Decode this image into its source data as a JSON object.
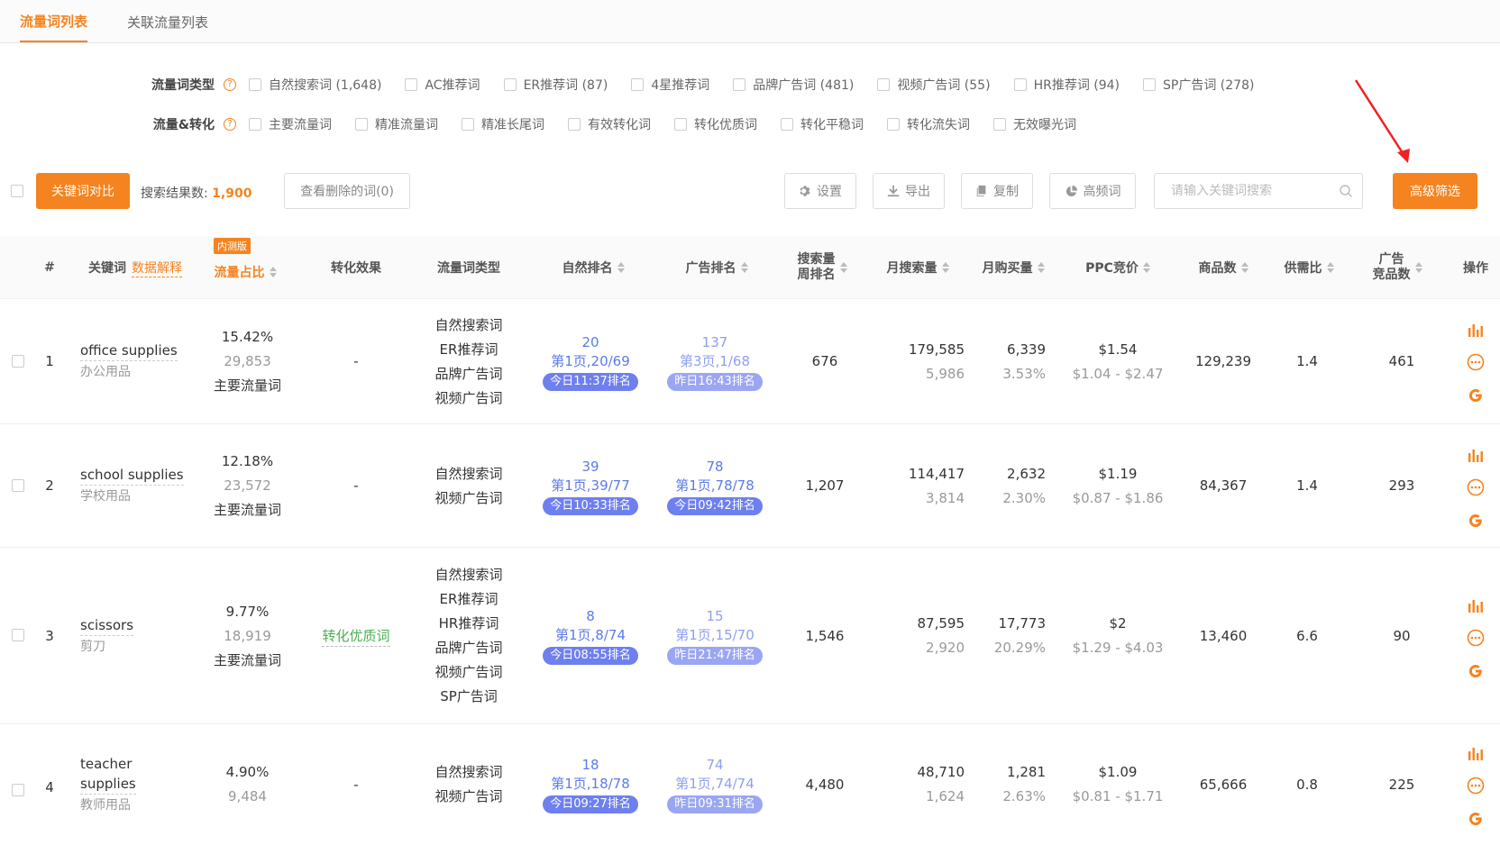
{
  "tabs": [
    {
      "label": "流量词列表"
    },
    {
      "label": "关联流量列表"
    }
  ],
  "filters": {
    "type_label": "流量词类型",
    "type_options": [
      "自然搜索词 (1,648)",
      "AC推荐词",
      "ER推荐词 (87)",
      "4星推荐词",
      "品牌广告词 (481)",
      "视频广告词 (55)",
      "HR推荐词 (94)",
      "SP广告词 (278)"
    ],
    "conv_label": "流量&转化",
    "conv_options": [
      "主要流量词",
      "精准流量词",
      "精准长尾词",
      "有效转化词",
      "转化优质词",
      "转化平稳词",
      "转化流失词",
      "无效曝光词"
    ]
  },
  "toolbar": {
    "compare_label": "关键词对比",
    "result_label": "搜索结果数:",
    "result_count": "1,900",
    "deleted_label": "查看删除的词(0)",
    "settings_label": "设置",
    "export_label": "导出",
    "copy_label": "复制",
    "highfreq_label": "高频词",
    "search_placeholder": "请输入关键词搜索",
    "advanced_label": "高级筛选"
  },
  "header": {
    "index": "#",
    "keyword": "关键词",
    "data_explain": "数据解释",
    "beta": "内测版",
    "share": "流量占比",
    "conversion": "转化效果",
    "type": "流量词类型",
    "natural_rank": "自然排名",
    "ad_rank": "广告排名",
    "weekly_rank_1": "搜索量",
    "weekly_rank_2": "周排名",
    "monthly_search": "月搜索量",
    "monthly_buy": "月购买量",
    "ppc": "PPC竞价",
    "products": "商品数",
    "supply": "供需比",
    "ad_comp_1": "广告",
    "ad_comp_2": "竞品数",
    "ops": "操作"
  },
  "rows": [
    {
      "index": "1",
      "kw_en": "office supplies",
      "kw_cn": "办公用品",
      "share": "15.42%",
      "share_count": "29,853",
      "share_type": "主要流量词",
      "conversion": "-",
      "types": [
        "自然搜索词",
        "ER推荐词",
        "品牌广告词",
        "视频广告词"
      ],
      "nat_rank": "20",
      "nat_page": "第1页,20/69",
      "nat_time": "今日11:37排名",
      "ad_rank": "137",
      "ad_page": "第3页,1/68",
      "ad_time": "昨日16:43排名",
      "weekly_rank": "676",
      "monthly_search": "179,585",
      "monthly_search_sub": "5,986",
      "monthly_buy": "6,339",
      "monthly_buy_rate": "3.53%",
      "ppc": "$1.54",
      "ppc_range": "$1.04 - $2.47",
      "products": "129,239",
      "supply": "1.4",
      "ad_comp": "461"
    },
    {
      "index": "2",
      "kw_en": "school supplies",
      "kw_cn": "学校用品",
      "share": "12.18%",
      "share_count": "23,572",
      "share_type": "主要流量词",
      "conversion": "-",
      "types": [
        "自然搜索词",
        "视频广告词"
      ],
      "nat_rank": "39",
      "nat_page": "第1页,39/77",
      "nat_time": "今日10:33排名",
      "ad_rank": "78",
      "ad_page": "第1页,78/78",
      "ad_time": "今日09:42排名",
      "weekly_rank": "1,207",
      "monthly_search": "114,417",
      "monthly_search_sub": "3,814",
      "monthly_buy": "2,632",
      "monthly_buy_rate": "2.30%",
      "ppc": "$1.19",
      "ppc_range": "$0.87 - $1.86",
      "products": "84,367",
      "supply": "1.4",
      "ad_comp": "293"
    },
    {
      "index": "3",
      "kw_en": "scissors",
      "kw_cn": "剪刀",
      "share": "9.77%",
      "share_count": "18,919",
      "share_type": "主要流量词",
      "conversion": "转化优质词",
      "types": [
        "自然搜索词",
        "ER推荐词",
        "HR推荐词",
        "品牌广告词",
        "视频广告词",
        "SP广告词"
      ],
      "nat_rank": "8",
      "nat_page": "第1页,8/74",
      "nat_time": "今日08:55排名",
      "ad_rank": "15",
      "ad_page": "第1页,15/70",
      "ad_time": "昨日21:47排名",
      "weekly_rank": "1,546",
      "monthly_search": "87,595",
      "monthly_search_sub": "2,920",
      "monthly_buy": "17,773",
      "monthly_buy_rate": "20.29%",
      "ppc": "$2",
      "ppc_range": "$1.29 - $4.03",
      "products": "13,460",
      "supply": "6.6",
      "ad_comp": "90"
    },
    {
      "index": "4",
      "kw_en_1": "teacher",
      "kw_en_2": "supplies",
      "kw_cn": "教师用品",
      "share": "4.90%",
      "share_count": "9,484",
      "conversion": "-",
      "types": [
        "自然搜索词",
        "视频广告词"
      ],
      "nat_rank": "18",
      "nat_page": "第1页,18/78",
      "nat_time": "今日09:27排名",
      "ad_rank": "74",
      "ad_page": "第1页,74/74",
      "ad_time": "昨日09:31排名",
      "weekly_rank": "4,480",
      "monthly_search": "48,710",
      "monthly_search_sub": "1,624",
      "monthly_buy": "1,281",
      "monthly_buy_rate": "2.63%",
      "ppc": "$1.09",
      "ppc_range": "$0.81 - $1.71",
      "products": "65,666",
      "supply": "0.8",
      "ad_comp": "225"
    }
  ],
  "colors": {
    "accent": "#f5831f",
    "rank_blue": "#5b7be8",
    "pill": "#6e7fef",
    "green": "#4caf50",
    "google_orange": "#f5831f"
  },
  "icons": [
    "question-icon",
    "gear-icon",
    "download-icon",
    "copy-icon",
    "pie-chart-icon",
    "search-icon",
    "bar-chart-icon",
    "more-circle-icon",
    "google-icon"
  ]
}
